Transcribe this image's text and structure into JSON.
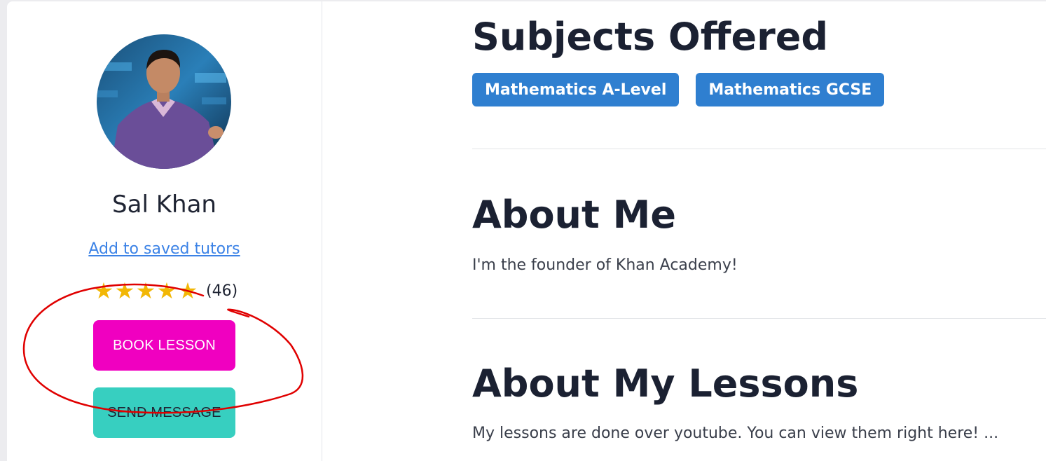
{
  "tutor": {
    "name": "Sal Khan",
    "save_link": "Add to saved tutors",
    "rating_stars": 5,
    "star_glyphs": [
      "★",
      "★",
      "★",
      "★",
      "★"
    ],
    "review_count": "(46)",
    "book_button": "BOOK LESSON",
    "message_button": "SEND MESSAGE"
  },
  "sections": {
    "subjects": {
      "heading": "Subjects Offered",
      "tags": [
        "Mathematics A-Level",
        "Mathematics GCSE"
      ]
    },
    "about_me": {
      "heading": "About Me",
      "text": "I'm the founder of Khan Academy!"
    },
    "about_lessons": {
      "heading": "About My Lessons",
      "text": "My lessons are done over youtube. You can view them right here! ..."
    }
  },
  "colors": {
    "book_button": "#f000c0",
    "message_button": "#37cfc0",
    "tag": "#2f7fd0",
    "link": "#3b82e6",
    "star": "#f2b705",
    "annotation": "#e00000"
  }
}
